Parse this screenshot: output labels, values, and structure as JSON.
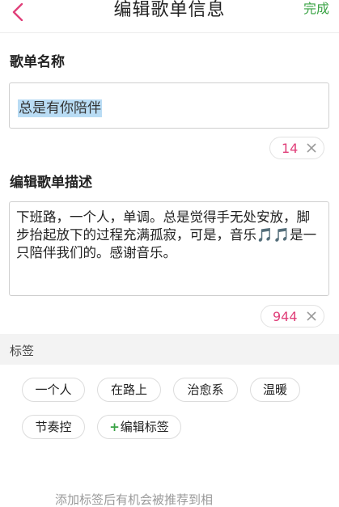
{
  "header": {
    "title": "编辑歌单信息",
    "done_label": "完成",
    "back_icon": "chevron-left-icon",
    "colors": {
      "done": "#3aa345",
      "back": "#e0407a"
    }
  },
  "name_section": {
    "label": "歌单名称",
    "value": "总是有你陪伴",
    "remaining": "14"
  },
  "desc_section": {
    "label": "编辑歌单描述",
    "value": "下班路，一个人，单调。总是觉得手无处安放，脚步抬起放下的过程充满孤寂，可是，音乐🎵🎵是一只陪伴我们的。感谢音乐。",
    "remaining": "944"
  },
  "tags_section": {
    "label": "标签",
    "tags": [
      "一个人",
      "在路上",
      "治愈系",
      "温暖",
      "节奏控"
    ],
    "edit_plus": "+",
    "edit_label": "编辑标签"
  },
  "footer_hint": "添加标签后有机会被推荐到相",
  "accent_color": "#e0407a"
}
